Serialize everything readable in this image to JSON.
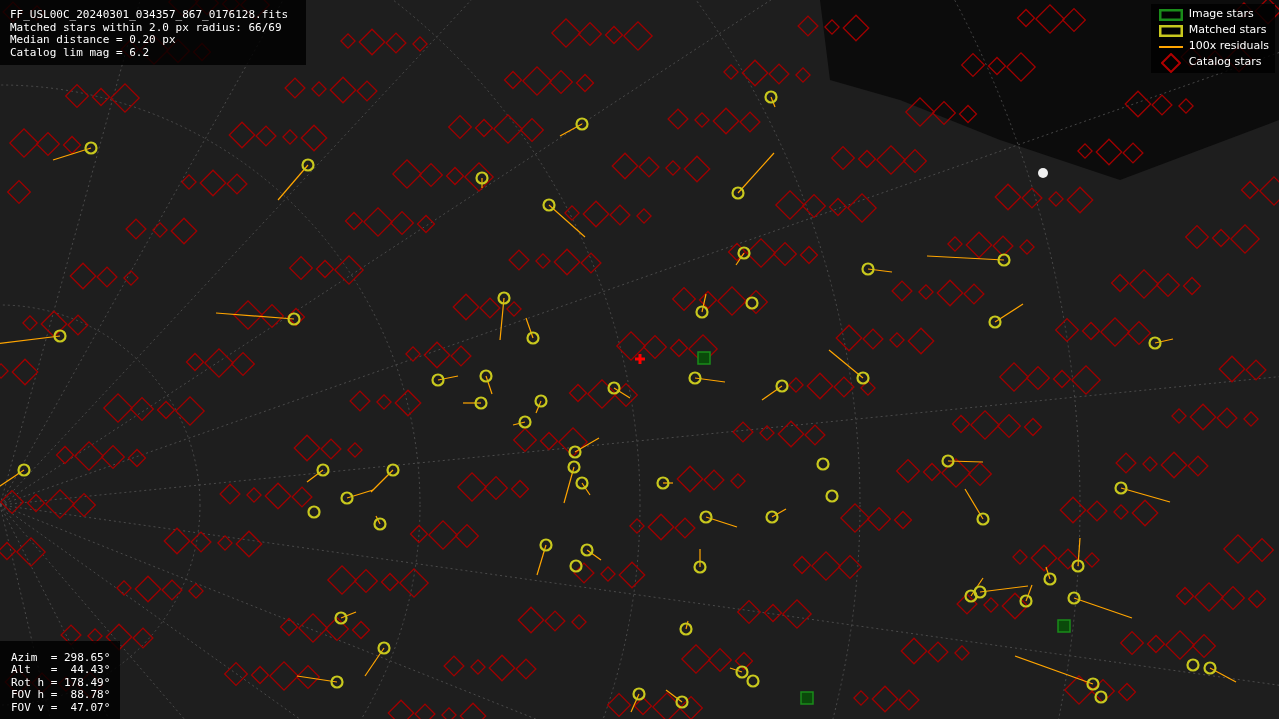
{
  "info_panel": {
    "lines": [
      "FF_USL00C_20240301_034357_867_0176128.fits",
      "Matched stars within 2.0 px radius: 66/69",
      "Median distance = 0.20 px",
      "Catalog lim mag = 6.2"
    ]
  },
  "legend": {
    "items": [
      {
        "kind": "box",
        "color": "#1a8c1a",
        "label": "Image stars"
      },
      {
        "kind": "box",
        "color": "#c8c81e",
        "label": "Matched stars"
      },
      {
        "kind": "line",
        "color": "#ffa500",
        "label": "100x residuals"
      },
      {
        "kind": "diamond",
        "color": "#b00000",
        "label": "Catalog stars"
      }
    ]
  },
  "pointing_panel": {
    "lines": [
      "Azim  = 298.65°",
      "Alt   =  44.43°",
      "Rot h = 178.49°",
      "FOV h =  88.78°",
      "FOV v =  47.07°"
    ]
  }
}
